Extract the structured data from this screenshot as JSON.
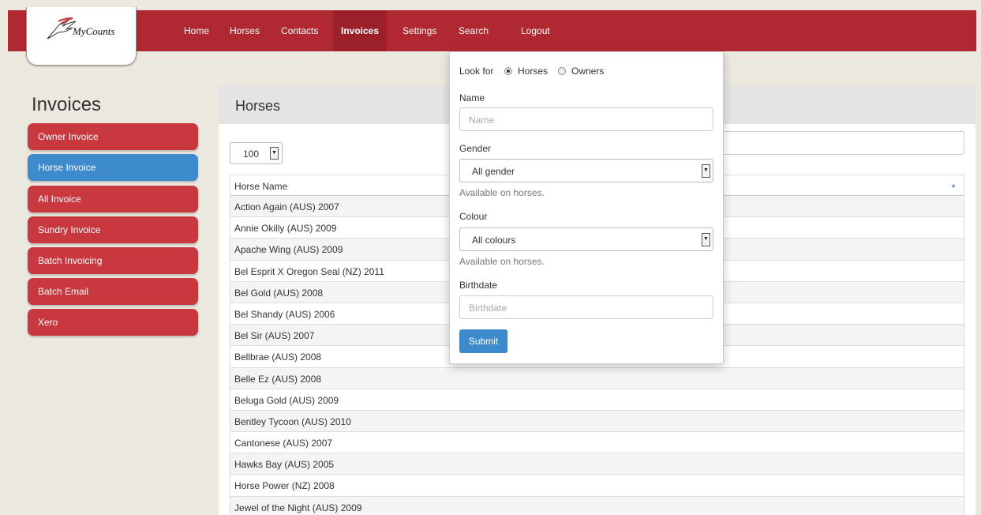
{
  "app": {
    "logo_text": "MyCounts"
  },
  "nav": {
    "items": [
      {
        "label": "Home"
      },
      {
        "label": "Horses"
      },
      {
        "label": "Contacts"
      },
      {
        "label": "Invoices"
      },
      {
        "label": "Settings"
      },
      {
        "label": "Search"
      },
      {
        "label": "Logout"
      }
    ],
    "active": "Invoices"
  },
  "sidebar": {
    "title": "Invoices",
    "items": [
      {
        "label": "Owner Invoice"
      },
      {
        "label": "Horse Invoice"
      },
      {
        "label": "All Invoice"
      },
      {
        "label": "Sundry Invoice"
      },
      {
        "label": "Batch Invoicing"
      },
      {
        "label": "Batch Email"
      },
      {
        "label": "Xero"
      }
    ],
    "active": "Horse Invoice"
  },
  "main": {
    "title": "Horses",
    "page_size": "100",
    "table": {
      "header": "Horse Name",
      "rows": [
        "Action Again (AUS) 2007",
        "Annie Okilly (AUS) 2009",
        "Apache Wing (AUS) 2009",
        "Bel Esprit X Oregon Seal (NZ) 2011",
        "Bel Gold (AUS) 2008",
        "Bel Shandy (AUS) 2006",
        "Bel Sir (AUS) 2007",
        "Bellbrae (AUS) 2008",
        "Belle Ez (AUS) 2008",
        "Beluga Gold (AUS) 2009",
        "Bentley Tycoon (AUS) 2010",
        "Cantonese (AUS) 2007",
        "Hawks Bay (AUS) 2005",
        "Horse Power (NZ) 2008",
        "Jewel of the Night (AUS) 2009"
      ]
    }
  },
  "search_dropdown": {
    "look_for_label": "Look for",
    "option_horses": "Horses",
    "option_owners": "Owners",
    "selected": "Horses",
    "name_label": "Name",
    "name_placeholder": "Name",
    "gender_label": "Gender",
    "gender_value": "All gender",
    "gender_help": "Available on horses.",
    "colour_label": "Colour",
    "colour_value": "All colours",
    "colour_help": "Available on horses.",
    "birthdate_label": "Birthdate",
    "birthdate_placeholder": "Birthdate",
    "submit_label": "Submit"
  },
  "colors": {
    "navbar": "#b02932",
    "sidebar_button": "#c9373f",
    "active_blue": "#3d8bcd"
  }
}
